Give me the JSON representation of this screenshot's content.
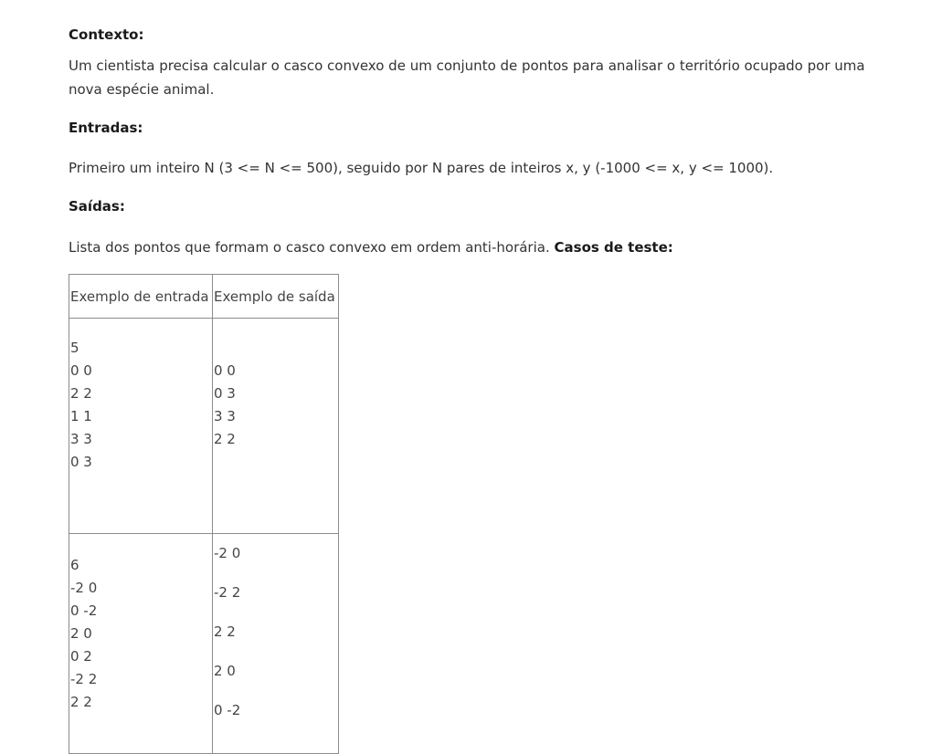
{
  "sections": {
    "context_title": "Contexto:",
    "context_text": "Um cientista precisa calcular o casco convexo de um conjunto de pontos para analisar o território ocupado por uma nova espécie animal.",
    "inputs_title": "Entradas:",
    "inputs_text": "Primeiro um inteiro N (3 <= N <= 500), seguido por N pares de inteiros x, y (-1000 <= x, y <= 1000).",
    "outputs_title": "Saídas:",
    "outputs_text": "Lista dos pontos que formam o casco convexo em ordem anti-horária.",
    "cases_title": "Casos de teste:"
  },
  "table": {
    "headers": [
      "Exemplo de entrada",
      "Exemplo de saída"
    ],
    "rows": [
      {
        "input": [
          "5",
          "0 0",
          "2 2",
          "1 1",
          "3 3",
          "0 3"
        ],
        "output": [
          "0 0",
          "0 3",
          "3 3",
          "2 2"
        ]
      },
      {
        "input": [
          "6",
          "-2 0",
          "0 -2",
          "2 0",
          "0 2",
          "-2 2",
          "2 2"
        ],
        "output": [
          "-2 0",
          "-2 2",
          "2 2",
          "2 0",
          "0 -2"
        ]
      }
    ]
  }
}
